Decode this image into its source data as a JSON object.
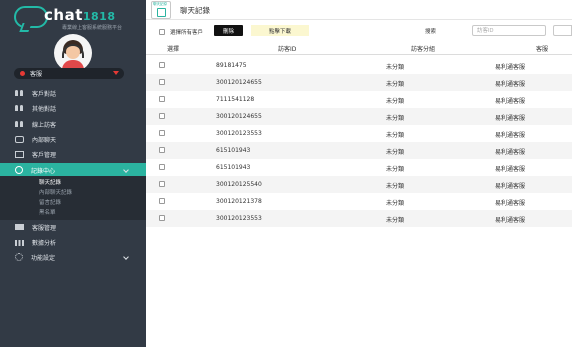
{
  "brand": {
    "name": "chat",
    "number": "1818",
    "tagline": "專業線上客服系統服務平台"
  },
  "sidebar": {
    "status": "客服",
    "nav": [
      {
        "label": "客戶對話",
        "icon": "people-icon"
      },
      {
        "label": "其他對話",
        "icon": "people-icon"
      },
      {
        "label": "線上訪客",
        "icon": "people-icon"
      },
      {
        "label": "內部聊天",
        "icon": "chat-icon"
      },
      {
        "label": "客戶管理",
        "icon": "box-icon"
      },
      {
        "label": "記錄中心",
        "icon": "clock-icon",
        "active": true
      }
    ],
    "sub": [
      "聊天記錄",
      "內部聊天記錄",
      "留言記錄",
      "黑名單"
    ],
    "nav2": [
      {
        "label": "客服管理",
        "icon": "card-icon"
      },
      {
        "label": "數據分析",
        "icon": "bar-chart-icon"
      },
      {
        "label": "功能設定",
        "icon": "gears-icon"
      }
    ]
  },
  "header": {
    "icon_label": "聊天記錄",
    "title": "聊天記錄"
  },
  "toolbar": {
    "select_all": "選擇所有客戶",
    "delete": "刪除",
    "download": "點擊下載",
    "search_label": "搜索",
    "search_placeholder": "訪客ID"
  },
  "table": {
    "columns": [
      "選擇",
      "訪客ID",
      "訪客分組",
      "客服"
    ],
    "rows": [
      {
        "id": "89181475",
        "group": "未分類",
        "agent": "易利通客服"
      },
      {
        "id": "300120124655",
        "group": "未分類",
        "agent": "易利通客服"
      },
      {
        "id": "7111541128",
        "group": "未分類",
        "agent": "易利通客服"
      },
      {
        "id": "300120124655",
        "group": "未分類",
        "agent": "易利通客服"
      },
      {
        "id": "300120123553",
        "group": "未分類",
        "agent": "易利通客服"
      },
      {
        "id": "615101943",
        "group": "未分類",
        "agent": "易利通客服"
      },
      {
        "id": "615101943",
        "group": "未分類",
        "agent": "易利通客服"
      },
      {
        "id": "300120125540",
        "group": "未分類",
        "agent": "易利通客服"
      },
      {
        "id": "300120121378",
        "group": "未分類",
        "agent": "易利通客服"
      },
      {
        "id": "300120123553",
        "group": "未分類",
        "agent": "易利通客服"
      }
    ]
  },
  "colors": {
    "sidebar": "#323a45",
    "accent": "#2bb3a0",
    "status": "#e53935"
  }
}
